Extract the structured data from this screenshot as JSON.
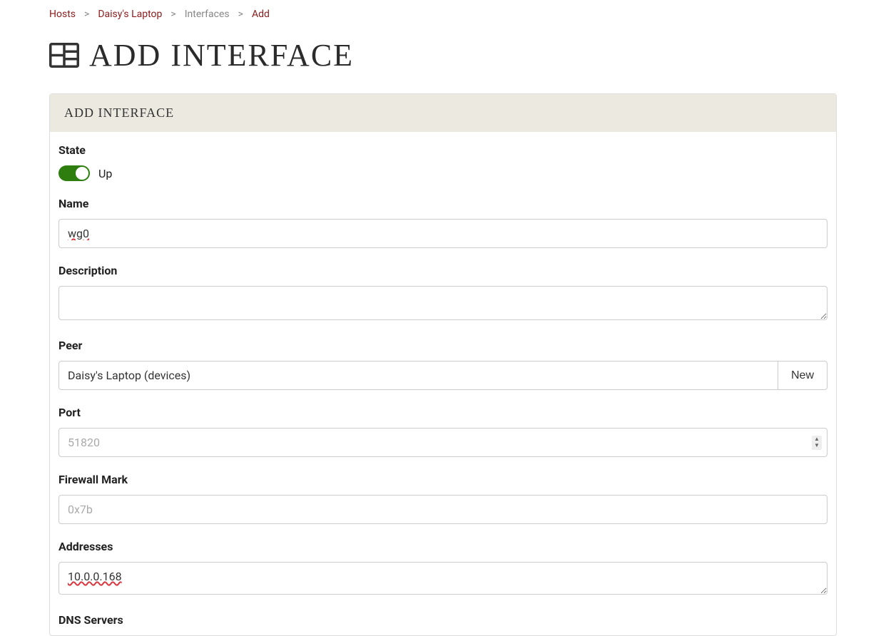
{
  "breadcrumb": {
    "hosts": "Hosts",
    "host": "Daisy's Laptop",
    "interfaces": "Interfaces",
    "add": "Add",
    "sep": ">"
  },
  "pageTitle": "ADD INTERFACE",
  "panel": {
    "header": "ADD INTERFACE",
    "state": {
      "label": "State",
      "valueLabel": "Up",
      "on": true
    },
    "name": {
      "label": "Name",
      "value": "wg0"
    },
    "description": {
      "label": "Description",
      "value": ""
    },
    "peer": {
      "label": "Peer",
      "selected": "Daisy's Laptop (devices)",
      "newLabel": "New"
    },
    "port": {
      "label": "Port",
      "value": "",
      "placeholder": "51820"
    },
    "firewallMark": {
      "label": "Firewall Mark",
      "value": "",
      "placeholder": "0x7b"
    },
    "addresses": {
      "label": "Addresses",
      "value": "10.0.0.168"
    },
    "dnsServers": {
      "label": "DNS Servers"
    }
  }
}
